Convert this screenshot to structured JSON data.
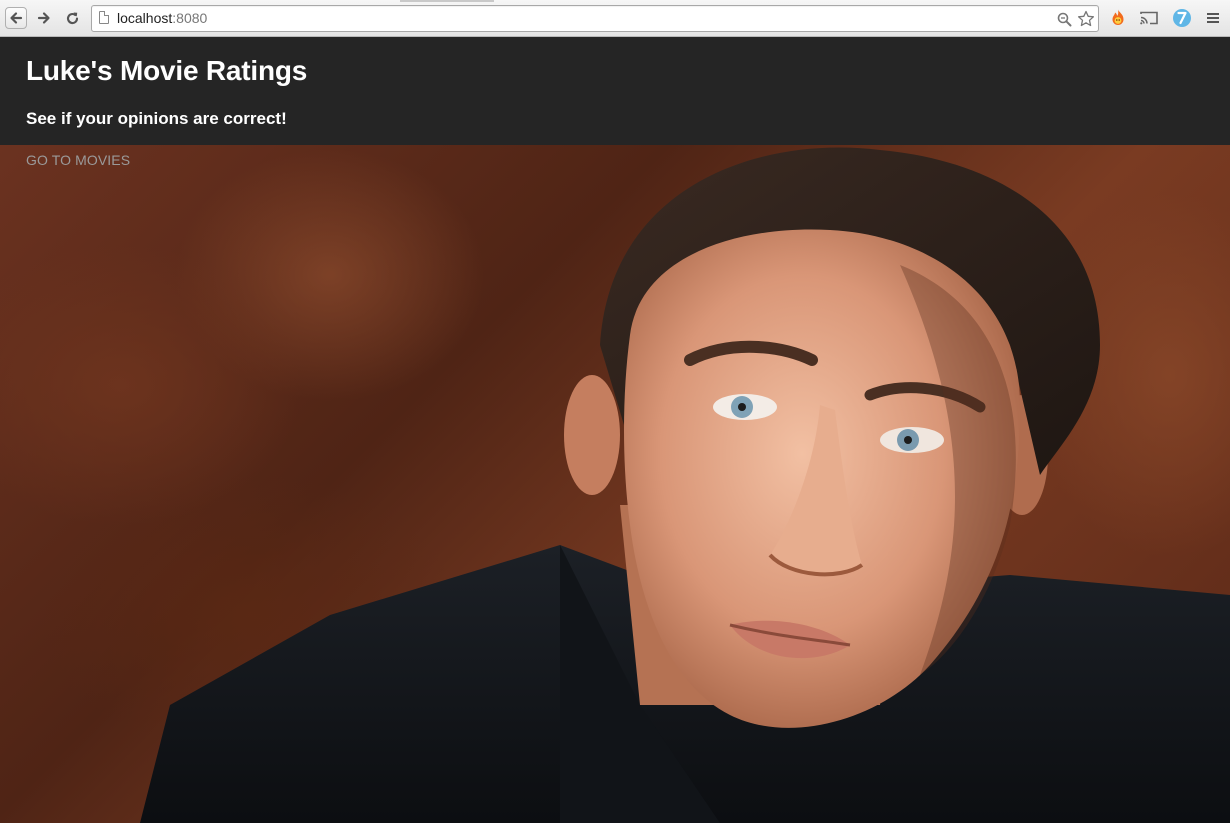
{
  "browser": {
    "url_host": "localhost",
    "url_port": ":8080",
    "icons": {
      "back": "back-arrow-icon",
      "forward": "forward-arrow-icon",
      "reload": "reload-icon",
      "page": "page-icon",
      "zoom": "zoom-icon",
      "bookmark": "star-icon",
      "extension_1": "fire-extension-icon",
      "cast": "cast-icon",
      "extension_2": "blue-extension-icon",
      "menu": "hamburger-menu-icon"
    }
  },
  "site": {
    "title": "Luke's Movie Ratings",
    "subtitle": "See if your opinions are correct!",
    "nav_link": "GO TO MOVIES"
  },
  "colors": {
    "header_bg": "#252525",
    "header_text": "#ffffff",
    "link_text": "#9a9a9a",
    "hero_background": "#5a2817"
  }
}
